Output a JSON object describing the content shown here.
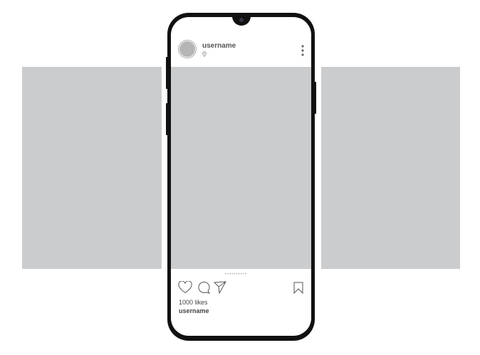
{
  "post": {
    "username": "username",
    "likes": "1000 likes",
    "caption_username": "username",
    "carousel_dots": "••••••••••"
  },
  "icons": [
    "location-pin-icon",
    "more-vertical-icon",
    "heart-icon",
    "comment-icon",
    "share-icon",
    "bookmark-icon"
  ],
  "colors": {
    "placeholder": "#cbcccd",
    "phone": "#111111"
  }
}
